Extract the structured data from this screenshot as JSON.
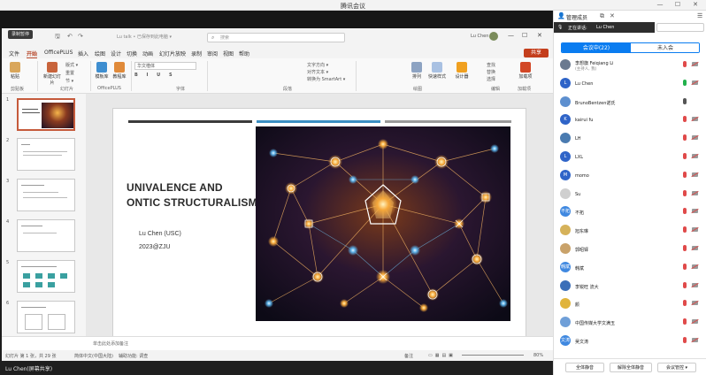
{
  "window": {
    "title": "腾讯会议"
  },
  "recording_label": "录制暂停",
  "ppt": {
    "filename": "Lu talk • 已保存到此电脑 ▾",
    "search_placeholder": "搜索",
    "user": "Lu Chen",
    "share": "共享",
    "tabs": [
      "文件",
      "开始",
      "OfficePLUS",
      "插入",
      "绘图",
      "设计",
      "切换",
      "动画",
      "幻灯片放映",
      "录制",
      "审阅",
      "视图",
      "帮助"
    ],
    "active_tab": "开始",
    "ribbon": {
      "groups": [
        "剪贴板",
        "幻灯片",
        "OfficePLUS",
        "字体",
        "段落",
        "绘图",
        "编辑",
        "加载项"
      ],
      "buttons": [
        "粘贴",
        "新建幻灯片",
        "重用幻灯片",
        "模板库",
        "教程库",
        "排列",
        "快速样式",
        "设计器",
        "查找",
        "替换",
        "选择",
        "加载项"
      ],
      "font_name": "华文楷体",
      "small": [
        "版式 ▾",
        "重置",
        "节 ▾",
        "文字方向 ▾",
        "对齐文本 ▾",
        "转换为 SmartArt ▾"
      ]
    },
    "slide_numbers": [
      "1",
      "2",
      "3",
      "4",
      "5",
      "6"
    ],
    "slide": {
      "title_line1": "UNIVALENCE AND",
      "title_line2": "ONTIC STRUCTURALISM",
      "author": "Lu Chen (USC)",
      "event": "2023@ZJU"
    },
    "notes_placeholder": "单击此处添加备注",
    "status": {
      "slide_count": "幻灯片 第 1 张，共 29 张",
      "language": "简体中文(中国大陆)",
      "accessibility": "辅助功能: 调查",
      "notes": "备注",
      "zoom": "80%"
    }
  },
  "bottom": {
    "name": "Lu Chen(屏幕共享)"
  },
  "panel": {
    "title": "管理成员",
    "speaking_label": "正在讲话:",
    "speaking_name": "Lu Chen",
    "tab_in_meeting": "会议中(22)",
    "tab_not_joined": "未入会",
    "members": [
      {
        "name": "李想旗 Feiqiang Li",
        "sub": "(主持人, 我)",
        "avatar": "",
        "color": "#6b7a8f",
        "mic": "muted",
        "cam": true
      },
      {
        "name": "Lu Chen",
        "sub": "",
        "avatar": "L",
        "color": "#2f64c8",
        "mic": "green",
        "cam": true
      },
      {
        "name": "BrunoBentzen诺氏",
        "sub": "",
        "avatar": "",
        "color": "#5d8fcf",
        "mic": "normal",
        "cam": false
      },
      {
        "name": "kairui fu",
        "sub": "",
        "avatar": "K",
        "color": "#2f64c8",
        "mic": "muted",
        "cam": true
      },
      {
        "name": "LH",
        "sub": "",
        "avatar": "",
        "color": "#4a7bb0",
        "mic": "muted",
        "cam": true
      },
      {
        "name": "LXL",
        "sub": "",
        "avatar": "L",
        "color": "#2f64c8",
        "mic": "muted",
        "cam": true
      },
      {
        "name": "momo",
        "sub": "",
        "avatar": "M",
        "color": "#2f64c8",
        "mic": "muted",
        "cam": true
      },
      {
        "name": "Su",
        "sub": "",
        "avatar": "",
        "color": "#cfcfcf",
        "mic": "muted",
        "cam": true
      },
      {
        "name": "不拓",
        "sub": "",
        "avatar": "不拓",
        "color": "#3f88e0",
        "mic": "muted",
        "cam": true
      },
      {
        "name": "旭东琳",
        "sub": "",
        "avatar": "",
        "color": "#d6b25a",
        "mic": "muted",
        "cam": true
      },
      {
        "name": "郭昭铎",
        "sub": "",
        "avatar": "",
        "color": "#c9a26a",
        "mic": "muted",
        "cam": true
      },
      {
        "name": "韩斌",
        "sub": "",
        "avatar": "韩斌",
        "color": "#3f88e0",
        "mic": "muted",
        "cam": true
      },
      {
        "name": "李锐旺 流大",
        "sub": "",
        "avatar": "",
        "color": "#3c6fb8",
        "mic": "muted",
        "cam": true
      },
      {
        "name": "颜",
        "sub": "",
        "avatar": "",
        "color": "#e0b43c",
        "mic": "muted",
        "cam": true
      },
      {
        "name": "中国传媒大学文满玉",
        "sub": "",
        "avatar": "",
        "color": "#6f9fd8",
        "mic": "muted",
        "cam": true
      },
      {
        "name": "吴文涛",
        "sub": "",
        "avatar": "文涛",
        "color": "#3f88e0",
        "mic": "muted",
        "cam": true
      }
    ],
    "footer": [
      "全体静音",
      "解除全体静音",
      "会议管控 ▾"
    ]
  }
}
